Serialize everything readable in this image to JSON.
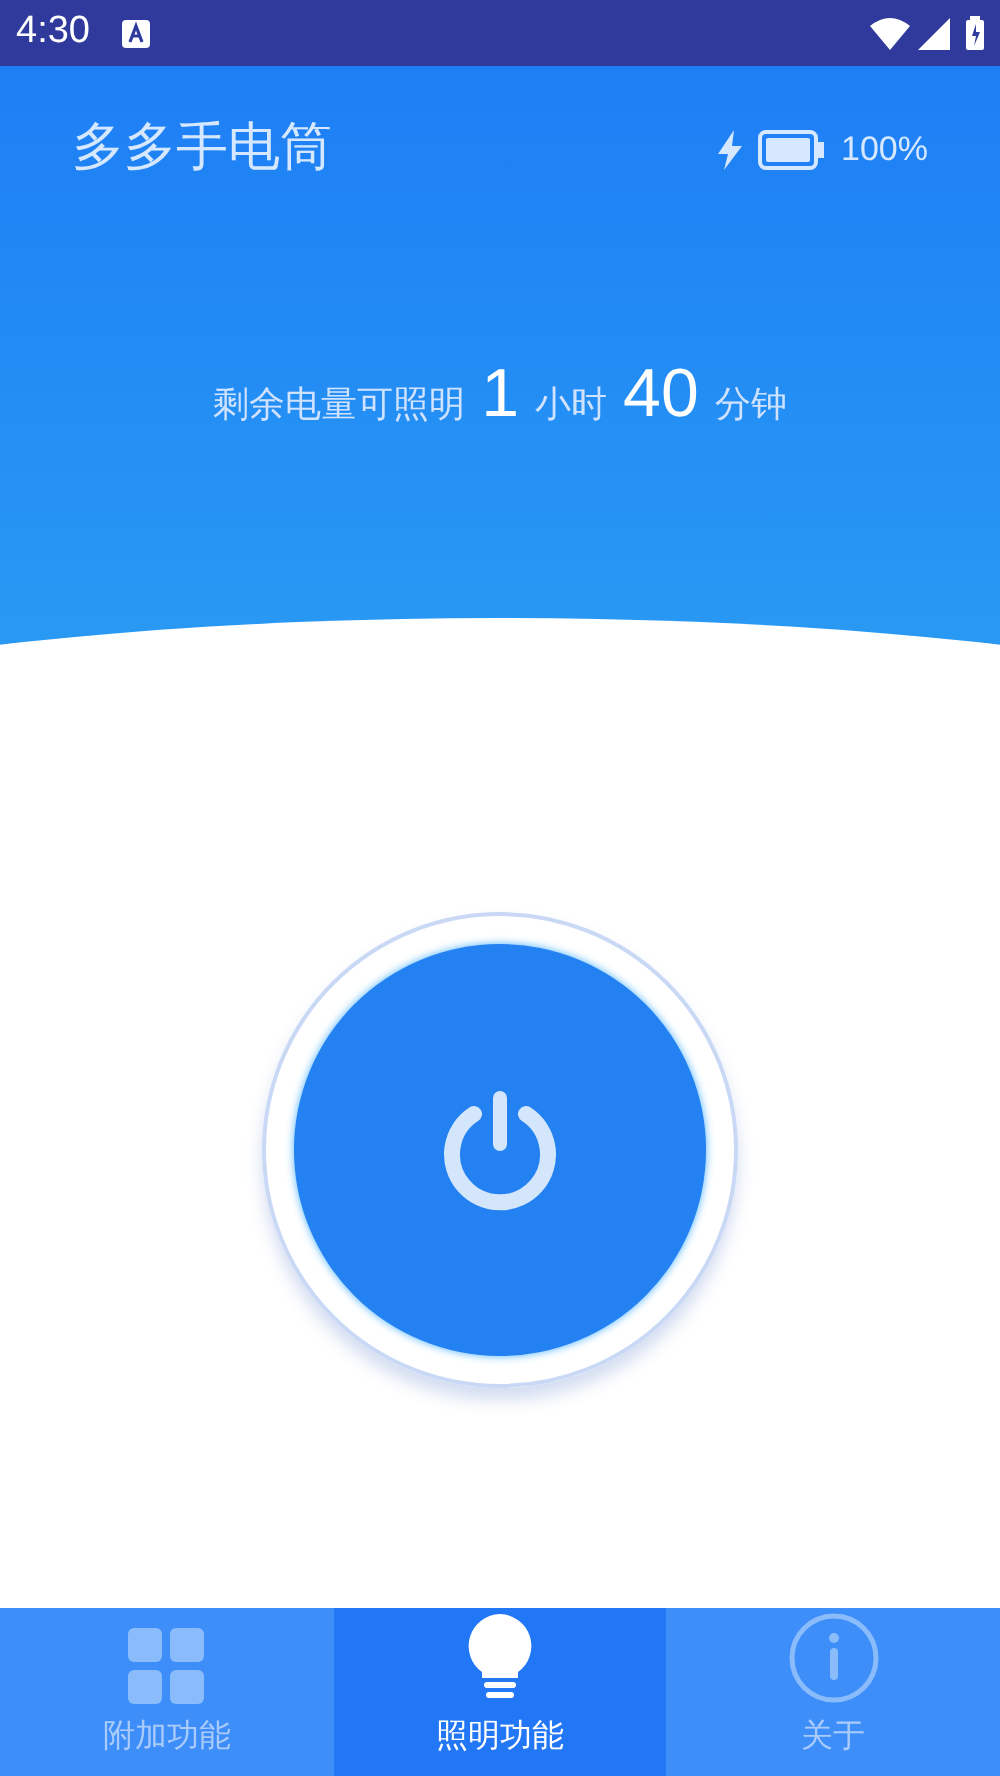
{
  "status_bar": {
    "time": "4:30"
  },
  "header": {
    "title": "多多手电筒",
    "battery_percent": "100%",
    "charging": true
  },
  "remaining": {
    "prefix": "剩余电量可照明",
    "hours": "1",
    "hours_unit": "小时",
    "minutes": "40",
    "minutes_unit": "分钟"
  },
  "nav": [
    {
      "label": "附加功能",
      "kind": "grid",
      "selected": false
    },
    {
      "label": "照明功能",
      "kind": "bulb",
      "selected": true
    },
    {
      "label": "关于",
      "kind": "info",
      "selected": false
    }
  ]
}
